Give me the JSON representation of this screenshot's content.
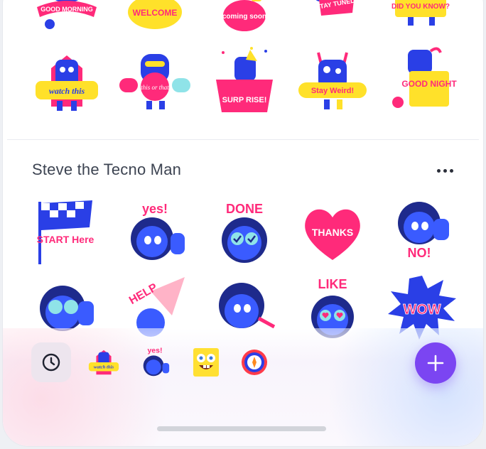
{
  "pack1": {
    "row1": [
      {
        "label": "GOOD MORNING"
      },
      {
        "label": "WELCOME"
      },
      {
        "label": "coming soon"
      },
      {
        "label": "STAY TUNED!"
      },
      {
        "label": "DID YOU KNOW?"
      }
    ],
    "row2": [
      {
        "label": "watch this"
      },
      {
        "label": "this or that"
      },
      {
        "label": "SURP RISE!"
      },
      {
        "label": "Stay Weird!"
      },
      {
        "label": "GOOD NIGHT"
      }
    ]
  },
  "pack2": {
    "title": "Steve the Tecno Man",
    "row1": [
      {
        "label": "START Here"
      },
      {
        "label": "yes!"
      },
      {
        "label": "DONE"
      },
      {
        "label": "THANKS"
      },
      {
        "label": "NO!"
      }
    ],
    "row2": [
      {
        "label": ""
      },
      {
        "label": "HELP"
      },
      {
        "label": ""
      },
      {
        "label": "LIKE"
      },
      {
        "label": "WOW"
      }
    ]
  },
  "tray": {
    "items": [
      {
        "name": "recent-icon"
      },
      {
        "name": "pack-watch-this",
        "label": "watch this"
      },
      {
        "name": "pack-steve",
        "label": "yes!"
      },
      {
        "name": "pack-sponge"
      },
      {
        "name": "pack-target"
      }
    ]
  },
  "colors": {
    "accent": "#7b45f2",
    "blue": "#2a3fe6",
    "pink": "#ff2a7a",
    "yellow": "#ffe12a"
  }
}
